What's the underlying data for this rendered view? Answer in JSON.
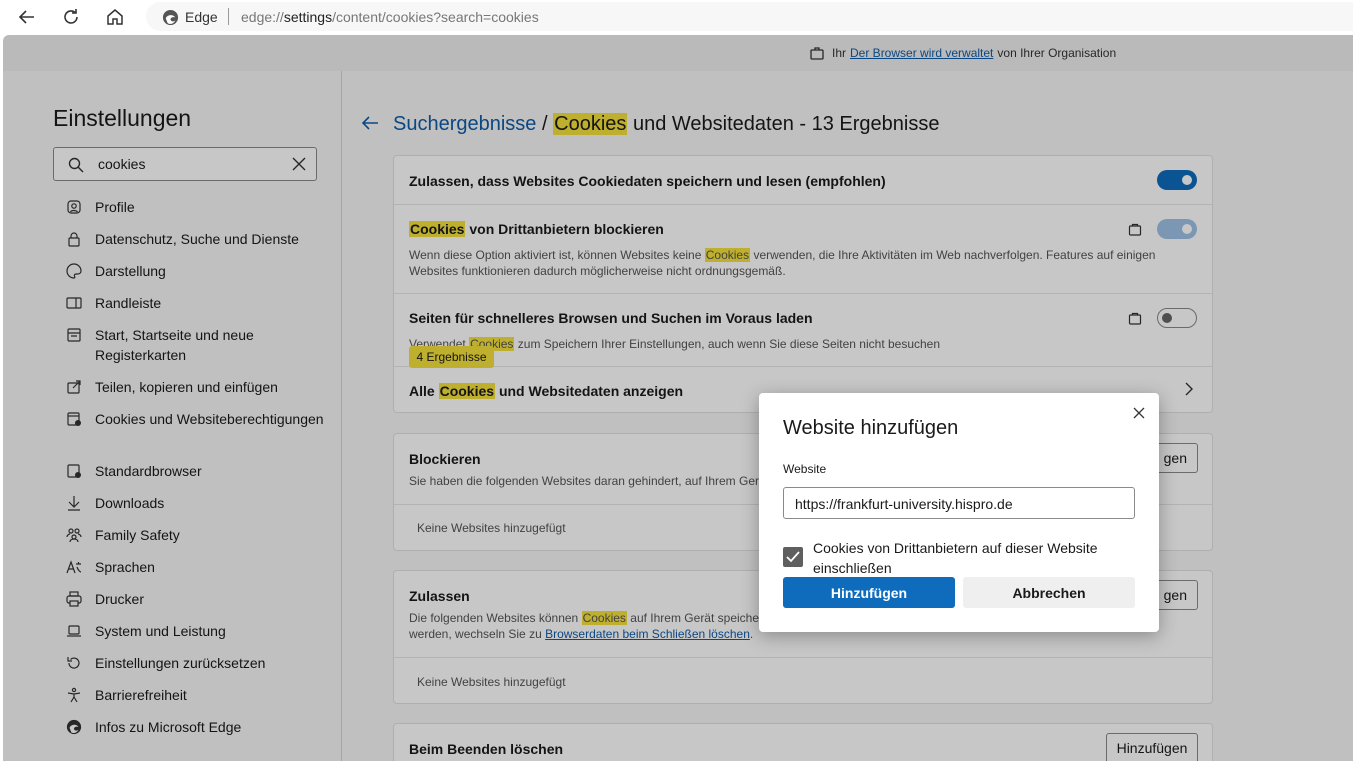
{
  "browser": {
    "edge_label": "Edge",
    "url_prefix": "edge://",
    "url_host": "settings",
    "url_path": "/content/cookies?search=cookies"
  },
  "banner": {
    "prefix": "Ihr",
    "link": "Der Browser wird verwaltet",
    "suffix": "von Ihrer Organisation"
  },
  "sidebar": {
    "title": "Einstellungen",
    "search_value": "cookies",
    "items": [
      {
        "label": "Profile",
        "icon": "profile-icon"
      },
      {
        "label": "Datenschutz, Suche und Dienste",
        "icon": "lock-icon"
      },
      {
        "label": "Darstellung",
        "icon": "appearance-icon"
      },
      {
        "label": "Randleiste",
        "icon": "sidebar-icon"
      },
      {
        "label": "Start, Startseite und neue Registerkarten",
        "icon": "home-tabs-icon"
      },
      {
        "label": "Teilen, kopieren und einfügen",
        "icon": "share-icon"
      },
      {
        "label": "Cookies und Websiteberechtigungen",
        "icon": "cookies-icon"
      },
      {
        "label": "Standardbrowser",
        "icon": "default-browser-icon"
      },
      {
        "label": "Downloads",
        "icon": "download-icon"
      },
      {
        "label": "Family Safety",
        "icon": "family-icon"
      },
      {
        "label": "Sprachen",
        "icon": "language-icon"
      },
      {
        "label": "Drucker",
        "icon": "printer-icon"
      },
      {
        "label": "System und Leistung",
        "icon": "laptop-icon"
      },
      {
        "label": "Einstellungen zurücksetzen",
        "icon": "reset-icon"
      },
      {
        "label": "Barrierefreiheit",
        "icon": "accessibility-icon"
      },
      {
        "label": "Infos zu Microsoft Edge",
        "icon": "edge-icon"
      }
    ]
  },
  "heading": {
    "link": "Suchergebnisse",
    "sep": "/",
    "highlight": "Cookies",
    "rest": "und Websitedaten - 13 Ergebnisse"
  },
  "card1": {
    "row1_title": "Zulassen, dass Websites Cookiedaten speichern und lesen (empfohlen)",
    "row2_title_hl": "Cookies",
    "row2_title_rest": "von Drittanbietern blockieren",
    "row2_desc_a": "Wenn diese Option aktiviert ist, können Websites keine",
    "row2_desc_hl": "Cookies",
    "row2_desc_b": "verwenden, die Ihre Aktivitäten im Web nachverfolgen. Features auf einigen Websites funktionieren dadurch möglicherweise nicht ordnungsgemäß.",
    "row3_title": "Seiten für schnelleres Browsen und Suchen im Voraus laden",
    "row3_desc_a": "Verwendet",
    "row3_desc_hl": "Cookies",
    "row3_desc_b": "zum Speichern Ihrer Einstellungen, auch wenn Sie diese Seiten nicht besuchen",
    "row4_a": "Alle",
    "row4_hl": "Cookies",
    "row4_b": "und Websitedaten anzeigen",
    "tooltip": "4 Ergebnisse"
  },
  "block": {
    "title": "Blockieren",
    "desc": "Sie haben die folgenden Websites daran gehindert, auf Ihrem Gerä",
    "button": "gen",
    "empty": "Keine Websites hinzugefügt"
  },
  "allow": {
    "title": "Zulassen",
    "desc_a": "Die folgenden Websites können",
    "desc_hl": "Cookies",
    "desc_b": "auf Ihrem Gerät speicher",
    "desc2_a": "werden, wechseln Sie zu",
    "desc2_link": "Browserdaten beim Schließen löschen",
    "desc2_b": ".",
    "button": "gen",
    "empty": "Keine Websites hinzugefügt"
  },
  "clear": {
    "title": "Beim Beenden löschen",
    "button": "Hinzufügen"
  },
  "dialog": {
    "title": "Website hinzufügen",
    "field_label": "Website",
    "field_value": "https://frankfurt-university.hispro.de",
    "checkbox_label": "Cookies von Drittanbietern auf dieser Website einschließen",
    "checkbox_checked": true,
    "add_button": "Hinzufügen",
    "cancel_button": "Abbrechen"
  },
  "colors": {
    "accent": "#0f6cbd",
    "highlight": "#f4e03b",
    "link": "#0f5ca8"
  }
}
